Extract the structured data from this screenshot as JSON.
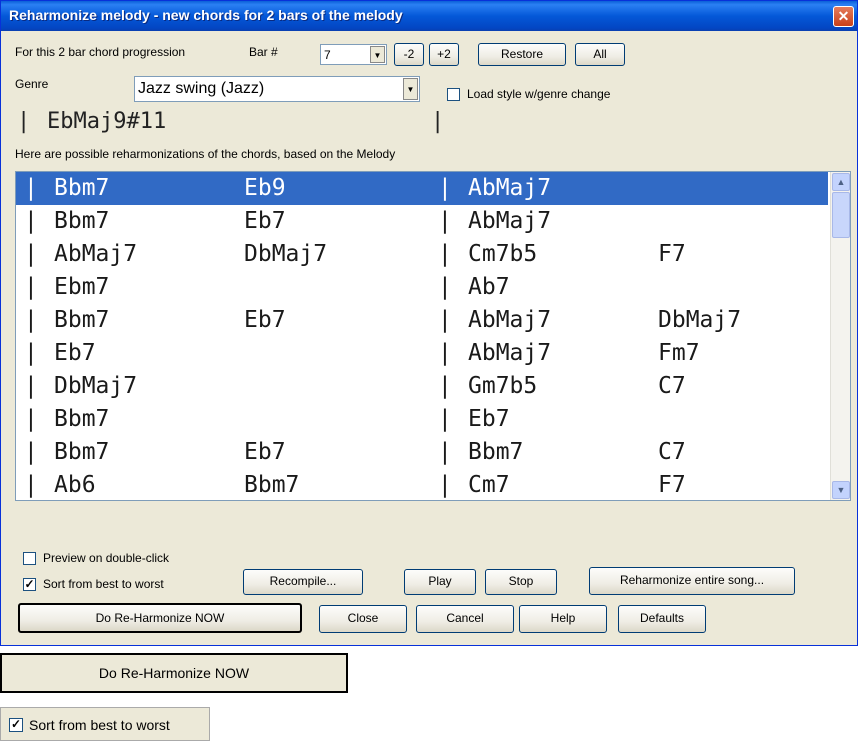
{
  "window": {
    "title": "Reharmonize melody - new chords for 2 bars of the melody",
    "close_symbol": "✕"
  },
  "progression_label": "For this 2 bar chord progression",
  "bar": {
    "label": "Bar #",
    "value": "7",
    "minus_label": "-2",
    "plus_label": "+2",
    "restore_label": "Restore",
    "all_label": "All"
  },
  "genre": {
    "label": "Genre",
    "value": "Jazz  swing (Jazz)",
    "load_style_label": "Load style w/genre change",
    "load_style_checked": false
  },
  "current_chords": {
    "bar_sep_1": "|",
    "chord": "EbMaj9#11",
    "bar_sep_2": "|"
  },
  "list_caption": "Here are possible reharmonizations of the chords, based on the Melody",
  "reharmonizations": [
    {
      "sep1": "|",
      "c1": "Bbm7",
      "c2": "Eb9",
      "sep2": "|",
      "c3": "AbMaj7",
      "c4": "",
      "selected": true
    },
    {
      "sep1": "|",
      "c1": "Bbm7",
      "c2": "Eb7",
      "sep2": "|",
      "c3": "AbMaj7",
      "c4": ""
    },
    {
      "sep1": "|",
      "c1": "AbMaj7",
      "c2": "DbMaj7",
      "sep2": "|",
      "c3": "Cm7b5",
      "c4": "F7"
    },
    {
      "sep1": "|",
      "c1": "Ebm7",
      "c2": "",
      "sep2": "|",
      "c3": "Ab7",
      "c4": ""
    },
    {
      "sep1": "|",
      "c1": "Bbm7",
      "c2": "Eb7",
      "sep2": "|",
      "c3": "AbMaj7",
      "c4": "DbMaj7"
    },
    {
      "sep1": "|",
      "c1": "Eb7",
      "c2": "",
      "sep2": "|",
      "c3": "AbMaj7",
      "c4": "Fm7"
    },
    {
      "sep1": "|",
      "c1": "DbMaj7",
      "c2": "",
      "sep2": "|",
      "c3": "Gm7b5",
      "c4": "C7"
    },
    {
      "sep1": "|",
      "c1": "Bbm7",
      "c2": "",
      "sep2": "|",
      "c3": "Eb7",
      "c4": ""
    },
    {
      "sep1": "|",
      "c1": "Bbm7",
      "c2": "Eb7",
      "sep2": "|",
      "c3": "Bbm7",
      "c4": "C7"
    },
    {
      "sep1": "|",
      "c1": "Ab6",
      "c2": "Bbm7",
      "sep2": "|",
      "c3": "Cm7",
      "c4": "F7"
    }
  ],
  "options": {
    "preview_label": "Preview on double-click",
    "preview_checked": false,
    "sort_label": "Sort from best to worst",
    "sort_checked": true,
    "check_mark": "✓"
  },
  "buttons": {
    "recompile": "Recompile...",
    "play": "Play",
    "stop": "Stop",
    "reharmonize_song": "Reharmonize entire song...",
    "do_reharmonize": "Do Re-Harmonize NOW",
    "close": "Close",
    "cancel": "Cancel",
    "help": "Help",
    "defaults": "Defaults"
  },
  "zoom_samples": {
    "do_reharmonize": "Do Re-Harmonize NOW",
    "sort_label": "Sort from best to worst",
    "check_mark": "✓"
  },
  "scroll": {
    "up": "▲",
    "down": "▼",
    "combo_arrow": "▼"
  }
}
